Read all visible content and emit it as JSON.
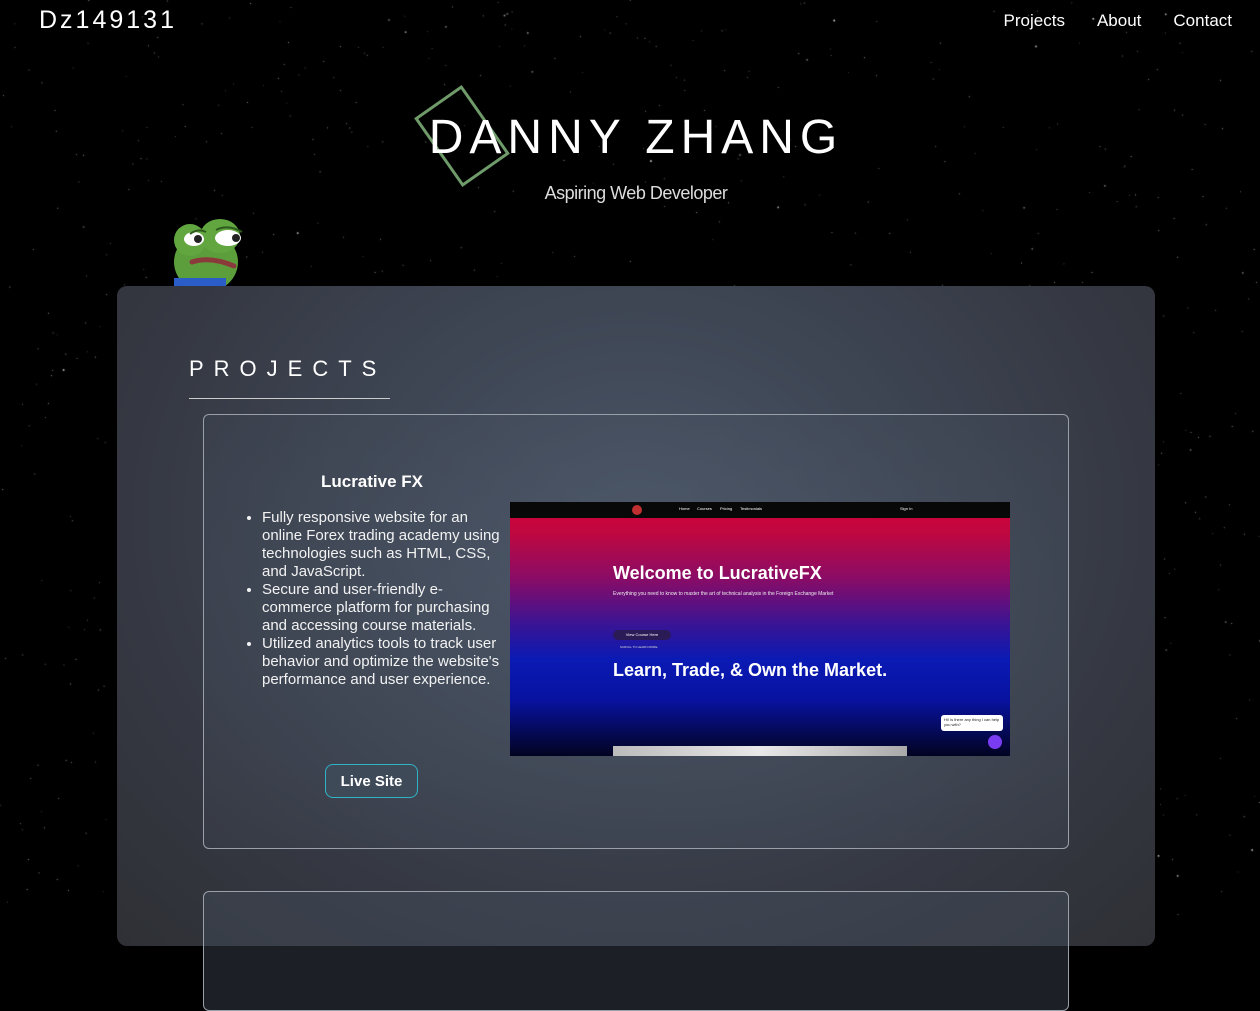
{
  "header": {
    "logo": "Dz149131",
    "nav": [
      "Projects",
      "About",
      "Contact"
    ]
  },
  "hero": {
    "title": "DANNY ZHANG",
    "subtitle": "Aspiring Web Developer"
  },
  "projects": {
    "section_title": "PROJECTS",
    "items": [
      {
        "title": "Lucrative FX",
        "bullets": [
          "Fully responsive website for an online Forex trading academy using technologies such as HTML, CSS, and JavaScript.",
          "Secure and user-friendly e-commerce platform for purchasing and accessing course materials.",
          "Utilized analytics tools to track user behavior and optimize the website's performance and user experience."
        ],
        "button": "Live Site",
        "screenshot": {
          "nav": [
            "Home",
            "Courses",
            "Pricing",
            "Testimonials"
          ],
          "sign_in": "Sign In",
          "heading": "Welcome to LucrativeFX",
          "tagline": "Everything you need to know to master the art of technical analysis in the Foreign Exchange Market",
          "cta": "View Course Here",
          "scroll": "SCROLL TO LEARN MORE",
          "heading2": "Learn, Trade, & Own the Market.",
          "chat": "Hi! Is there any thing I can help you with?"
        }
      }
    ]
  },
  "colors": {
    "accent": "#2fb3c6",
    "deco": "#6f9a6a",
    "panel": "#3e4654"
  },
  "icons": [
    "frog-mascot-icon",
    "messenger-icon"
  ]
}
